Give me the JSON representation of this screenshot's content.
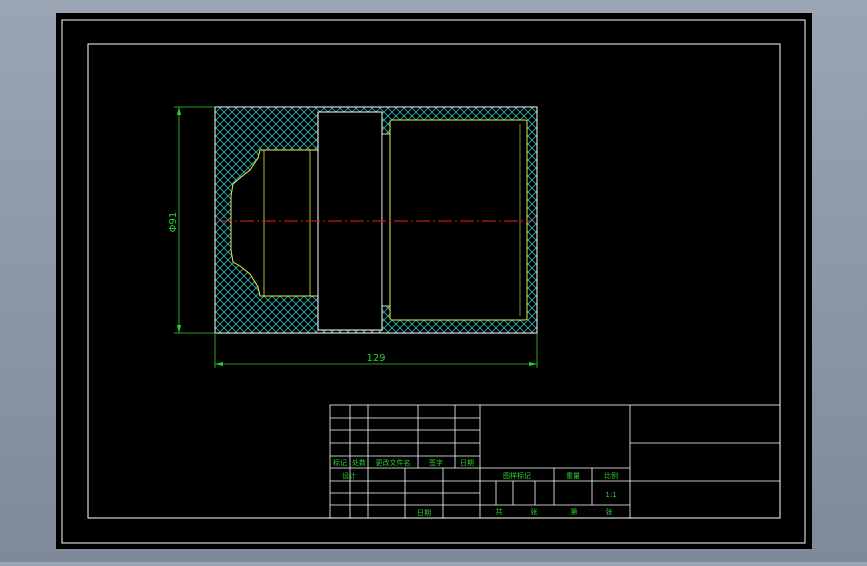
{
  "drawing": {
    "dimensions": {
      "diameter_label": "Φ91",
      "length_label": "129"
    },
    "title_block": {
      "revision_headers": [
        "标记",
        "处数",
        "更改文件名",
        "签字",
        "日期"
      ],
      "design_label": "设计",
      "date_label": "日期",
      "stage_labels": [
        "图样标记",
        "重量",
        "比例"
      ],
      "scale_value": "1:1",
      "sheet_labels": [
        "共",
        "张",
        "第",
        "张"
      ]
    },
    "colors": {
      "background": "#000000",
      "frame": "#ffffff",
      "part_outline": "#e8e850",
      "hatch": "#2fb3b3",
      "centerline": "#e02020",
      "dimension": "#28d228",
      "table_text": "#28d228"
    }
  }
}
